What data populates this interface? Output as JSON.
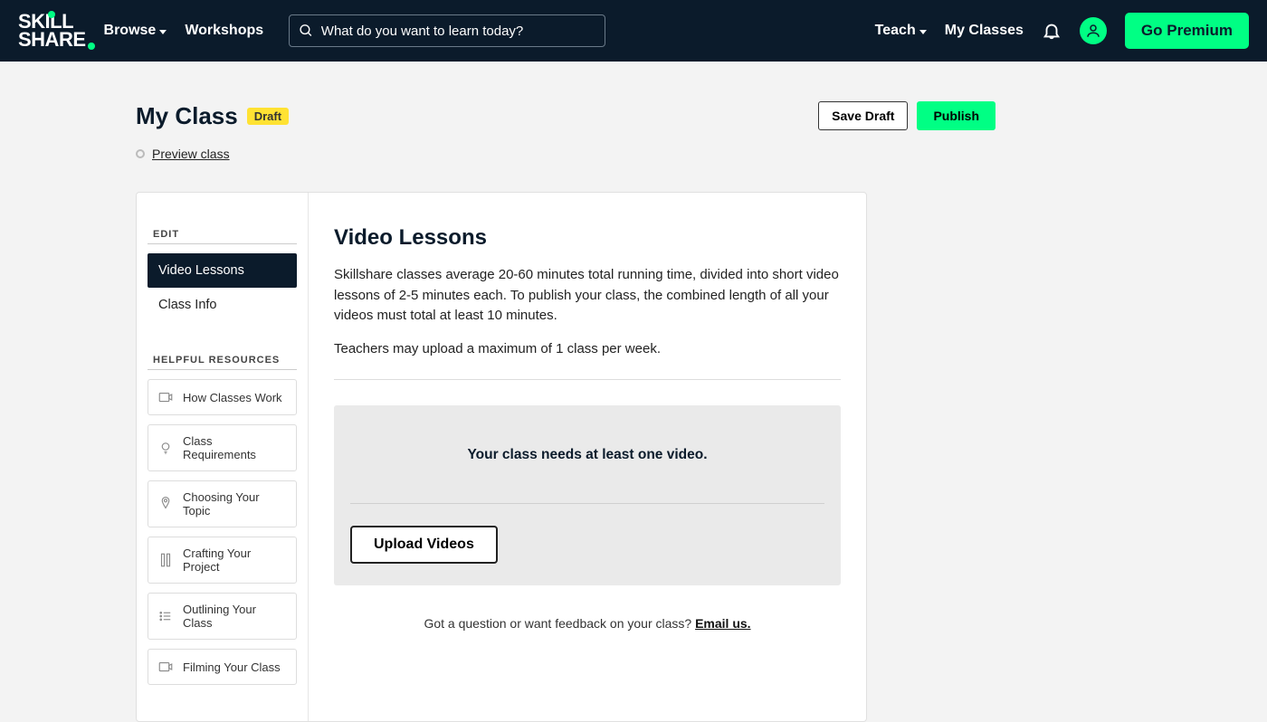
{
  "header": {
    "browse_label": "Browse",
    "workshops_label": "Workshops",
    "search_placeholder": "What do you want to learn today?",
    "teach_label": "Teach",
    "my_classes_label": "My Classes",
    "go_premium_label": "Go Premium"
  },
  "page": {
    "my_class_title": "My Class",
    "draft_badge": "Draft",
    "save_draft_label": "Save Draft",
    "publish_label": "Publish",
    "preview_label": "Preview class"
  },
  "sidebar": {
    "edit_heading": "EDIT",
    "item_video_lessons": "Video Lessons",
    "item_class_info": "Class Info",
    "resources_heading": "HELPFUL RESOURCES",
    "resources": [
      "How Classes Work",
      "Class Requirements",
      "Choosing Your Topic",
      "Crafting Your Project",
      "Outlining Your Class",
      "Filming Your Class"
    ]
  },
  "content": {
    "heading": "Video Lessons",
    "para1": "Skillshare classes average 20-60 minutes total running time, divided into short video lessons of 2-5 minutes each. To publish your class, the combined length of all your videos must total at least 10 minutes.",
    "para2": "Teachers may upload a maximum of 1 class per week.",
    "need_video_text": "Your class needs at least one video.",
    "upload_button": "Upload Videos",
    "question_text": "Got a question or want feedback on your class? ",
    "email_us": "Email us."
  }
}
